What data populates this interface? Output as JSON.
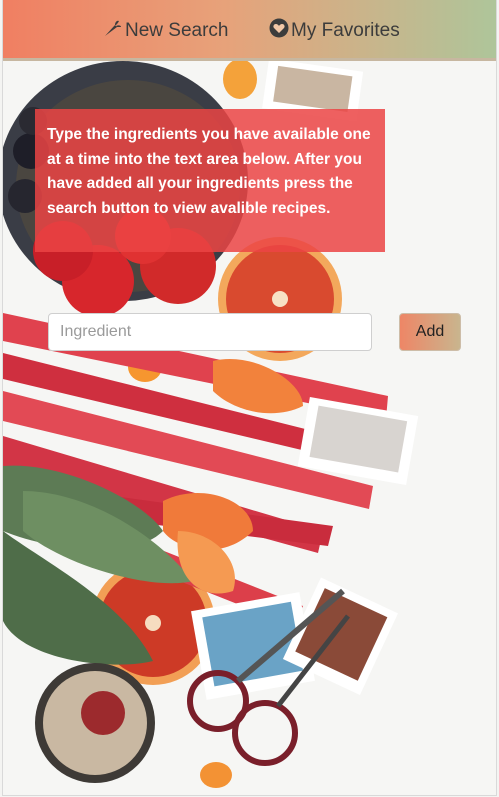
{
  "nav": {
    "new_search": {
      "label": "New Search",
      "icon": "carrot-icon"
    },
    "favorites": {
      "label": "My Favorites",
      "icon": "heart-circle-icon"
    }
  },
  "info": {
    "text": "Type the ingredients you have available one at a time into the text area below. After you have added all your ingredients press the search button to view avalible recipes."
  },
  "search": {
    "placeholder": "Ingredient",
    "value": "",
    "add_label": "Add"
  },
  "colors": {
    "nav_gradient_start": "#f07f62",
    "nav_gradient_end": "#aec59a",
    "info_box": "#eb4444",
    "add_button_start": "#ee8666",
    "add_button_end": "#c9b58e"
  }
}
